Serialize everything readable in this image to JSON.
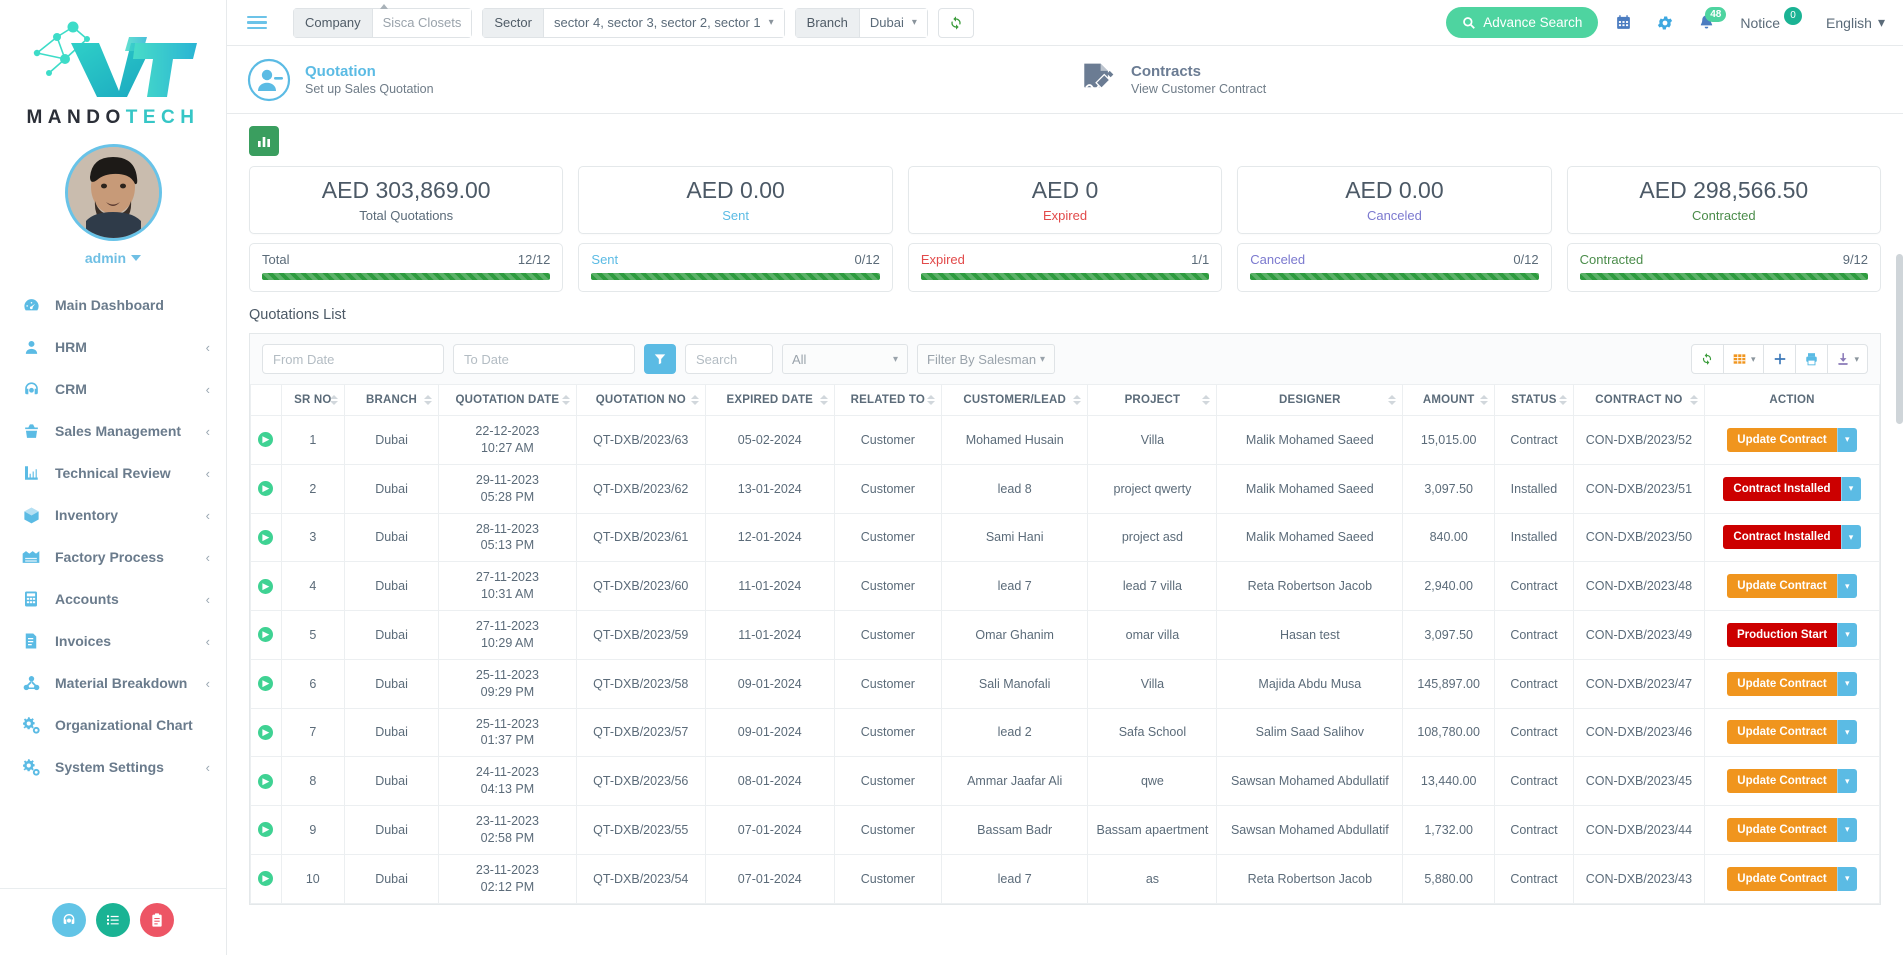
{
  "brand": {
    "name_dark": "MANDO",
    "name_teal": "TECH",
    "accent": "#36c6c6"
  },
  "sidebar": {
    "user": {
      "name": "admin"
    },
    "items": [
      {
        "label": "Main Dashboard",
        "icon": "dashboard-icon",
        "arrow": ""
      },
      {
        "label": "HRM",
        "icon": "user-icon",
        "arrow": "‹"
      },
      {
        "label": "CRM",
        "icon": "headset-icon",
        "arrow": "‹"
      },
      {
        "label": "Sales Management",
        "icon": "basket-icon",
        "arrow": "‹"
      },
      {
        "label": "Technical Review",
        "icon": "ruler-icon",
        "arrow": "‹"
      },
      {
        "label": "Inventory",
        "icon": "box-icon",
        "arrow": "‹"
      },
      {
        "label": "Factory Process",
        "icon": "factory-icon",
        "arrow": "‹"
      },
      {
        "label": "Accounts",
        "icon": "calculator-icon",
        "arrow": "‹"
      },
      {
        "label": "Invoices",
        "icon": "invoice-icon",
        "arrow": "‹"
      },
      {
        "label": "Material Breakdown",
        "icon": "molecule-icon",
        "arrow": "‹"
      },
      {
        "label": "Organizational Chart",
        "icon": "gears-icon",
        "arrow": ""
      },
      {
        "label": "System Settings",
        "icon": "gears-icon",
        "arrow": "‹"
      }
    ],
    "footer_buttons": [
      {
        "name": "support-button",
        "icon": "headset-icon",
        "color": "#62c4e6"
      },
      {
        "name": "tasklist-button",
        "icon": "list-icon",
        "color": "#1ab394"
      },
      {
        "name": "clipboard-button",
        "icon": "clipboard-icon",
        "color": "#ed5565"
      }
    ]
  },
  "topbar": {
    "company_label": "Company",
    "company_value": "Sisca Closets",
    "sector_label": "Sector",
    "sector_value": "sector 4, sector 3, sector 2, sector 1",
    "branch_label": "Branch",
    "branch_value": "Dubai",
    "refresh_icon": "refresh-icon",
    "advance_search": "Advance Search",
    "calendar_icon": "calendar-icon",
    "settings_icon": "gear-icon",
    "bell_icon": "bell-icon",
    "bell_count": "48",
    "notice_label": "Notice",
    "notice_count": "0",
    "language": "English"
  },
  "headcards": {
    "quotation": {
      "title": "Quotation",
      "subtitle": "Set up Sales Quotation",
      "icon": "user-minus-icon"
    },
    "contracts": {
      "title": "Contracts",
      "subtitle": "View Customer Contract",
      "icon": "contract-sign-icon"
    }
  },
  "chart_toggle": {
    "icon": "bar-chart-icon"
  },
  "stats": [
    {
      "amount": "AED 303,869.00",
      "label": "Total Quotations",
      "label_class": "c-total",
      "bar_label": "Total",
      "count": "12/12",
      "pct": 100
    },
    {
      "amount": "AED 0.00",
      "label": "Sent",
      "label_class": "c-sent",
      "bar_label": "Sent",
      "count": "0/12",
      "pct": 100
    },
    {
      "amount": "AED 0",
      "label": "Expired",
      "label_class": "c-expired",
      "bar_label": "Expired",
      "count": "1/1",
      "pct": 100
    },
    {
      "amount": "AED 0.00",
      "label": "Canceled",
      "label_class": "c-canceled",
      "bar_label": "Canceled",
      "count": "0/12",
      "pct": 100
    },
    {
      "amount": "AED 298,566.50",
      "label": "Contracted",
      "label_class": "c-contracted",
      "bar_label": "Contracted",
      "count": "9/12",
      "pct": 100
    }
  ],
  "list": {
    "title": "Quotations List",
    "from_date_placeholder": "From Date",
    "to_date_placeholder": "To Date",
    "filter_icon": "funnel-icon",
    "search_placeholder": "Search",
    "all_select": "All",
    "salesman_select": "Filter By Salesman",
    "toolbar": [
      {
        "name": "refresh-table-button",
        "icon": "refresh-icon"
      },
      {
        "name": "column-visibility-button",
        "icon": "columns-icon",
        "caret": "▾"
      },
      {
        "name": "add-button",
        "icon": "plus-icon"
      },
      {
        "name": "print-button",
        "icon": "printer-icon"
      },
      {
        "name": "export-button",
        "icon": "download-icon",
        "caret": "▾"
      }
    ],
    "columns": [
      "SR NO",
      "BRANCH",
      "QUOTATION DATE",
      "QUOTATION NO",
      "EXPIRED DATE",
      "RELATED TO",
      "CUSTOMER/LEAD",
      "PROJECT",
      "DESIGNER",
      "AMOUNT",
      "STATUS",
      "CONTRACT NO",
      "ACTION"
    ],
    "rows": [
      {
        "sr": "1",
        "branch": "Dubai",
        "date": "22-12-2023",
        "time": "10:27 AM",
        "qno": "QT-DXB/2023/63",
        "expired": "05-02-2024",
        "related": "Customer",
        "customer": "Mohamed Husain",
        "project": "Villa",
        "designer": "Malik Mohamed Saeed",
        "amount": "15,015.00",
        "status": "Contract",
        "contract": "CON-DXB/2023/52",
        "action": "Update Contract",
        "action_color": "orange"
      },
      {
        "sr": "2",
        "branch": "Dubai",
        "date": "29-11-2023",
        "time": "05:28 PM",
        "qno": "QT-DXB/2023/62",
        "expired": "13-01-2024",
        "related": "Customer",
        "customer": "lead 8",
        "project": "project qwerty",
        "designer": "Malik Mohamed Saeed",
        "amount": "3,097.50",
        "status": "Installed",
        "contract": "CON-DXB/2023/51",
        "action": "Contract Installed",
        "action_color": "red"
      },
      {
        "sr": "3",
        "branch": "Dubai",
        "date": "28-11-2023",
        "time": "05:13 PM",
        "qno": "QT-DXB/2023/61",
        "expired": "12-01-2024",
        "related": "Customer",
        "customer": "Sami Hani",
        "project": "project asd",
        "designer": "Malik Mohamed Saeed",
        "amount": "840.00",
        "status": "Installed",
        "contract": "CON-DXB/2023/50",
        "action": "Contract Installed",
        "action_color": "red"
      },
      {
        "sr": "4",
        "branch": "Dubai",
        "date": "27-11-2023",
        "time": "10:31 AM",
        "qno": "QT-DXB/2023/60",
        "expired": "11-01-2024",
        "related": "Customer",
        "customer": "lead 7",
        "project": "lead 7 villa",
        "designer": "Reta Robertson Jacob",
        "amount": "2,940.00",
        "status": "Contract",
        "contract": "CON-DXB/2023/48",
        "action": "Update Contract",
        "action_color": "orange"
      },
      {
        "sr": "5",
        "branch": "Dubai",
        "date": "27-11-2023",
        "time": "10:29 AM",
        "qno": "QT-DXB/2023/59",
        "expired": "11-01-2024",
        "related": "Customer",
        "customer": "Omar Ghanim",
        "project": "omar villa",
        "designer": "Hasan test",
        "amount": "3,097.50",
        "status": "Contract",
        "contract": "CON-DXB/2023/49",
        "action": "Production Start",
        "action_color": "red"
      },
      {
        "sr": "6",
        "branch": "Dubai",
        "date": "25-11-2023",
        "time": "09:29 PM",
        "qno": "QT-DXB/2023/58",
        "expired": "09-01-2024",
        "related": "Customer",
        "customer": "Sali Manofali",
        "project": "Villa",
        "designer": "Majida Abdu Musa",
        "amount": "145,897.00",
        "status": "Contract",
        "contract": "CON-DXB/2023/47",
        "action": "Update Contract",
        "action_color": "orange"
      },
      {
        "sr": "7",
        "branch": "Dubai",
        "date": "25-11-2023",
        "time": "01:37 PM",
        "qno": "QT-DXB/2023/57",
        "expired": "09-01-2024",
        "related": "Customer",
        "customer": "lead 2",
        "project": "Safa School",
        "designer": "Salim Saad Salihov",
        "amount": "108,780.00",
        "status": "Contract",
        "contract": "CON-DXB/2023/46",
        "action": "Update Contract",
        "action_color": "orange"
      },
      {
        "sr": "8",
        "branch": "Dubai",
        "date": "24-11-2023",
        "time": "04:13 PM",
        "qno": "QT-DXB/2023/56",
        "expired": "08-01-2024",
        "related": "Customer",
        "customer": "Ammar Jaafar Ali",
        "project": "qwe",
        "designer": "Sawsan Mohamed Abdullatif",
        "amount": "13,440.00",
        "status": "Contract",
        "contract": "CON-DXB/2023/45",
        "action": "Update Contract",
        "action_color": "orange"
      },
      {
        "sr": "9",
        "branch": "Dubai",
        "date": "23-11-2023",
        "time": "02:58 PM",
        "qno": "QT-DXB/2023/55",
        "expired": "07-01-2024",
        "related": "Customer",
        "customer": "Bassam Badr",
        "project": "Bassam apaertment",
        "designer": "Sawsan Mohamed Abdullatif",
        "amount": "1,732.00",
        "status": "Contract",
        "contract": "CON-DXB/2023/44",
        "action": "Update Contract",
        "action_color": "orange"
      },
      {
        "sr": "10",
        "branch": "Dubai",
        "date": "23-11-2023",
        "time": "02:12 PM",
        "qno": "QT-DXB/2023/54",
        "expired": "07-01-2024",
        "related": "Customer",
        "customer": "lead 7",
        "project": "as",
        "designer": "Reta Robertson Jacob",
        "amount": "5,880.00",
        "status": "Contract",
        "contract": "CON-DXB/2023/43",
        "action": "Update Contract",
        "action_color": "orange"
      }
    ]
  }
}
